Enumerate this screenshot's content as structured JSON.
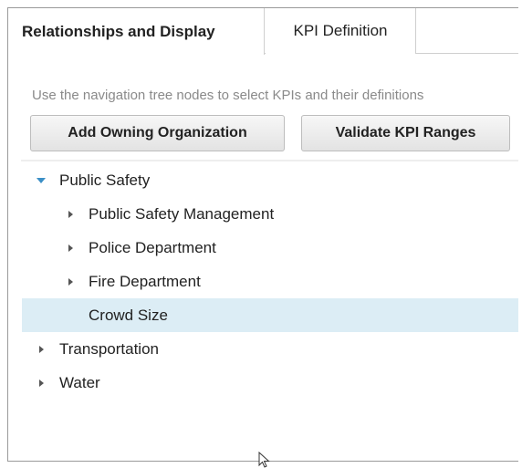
{
  "tabs": [
    {
      "label": "Relationships and Display",
      "active": true
    },
    {
      "label": "KPI Definition",
      "active": false
    }
  ],
  "hint_text": "Use the navigation tree nodes to select KPIs and their definitions",
  "buttons": {
    "add_owning": "Add Owning Organization",
    "validate": "Validate KPI Ranges"
  },
  "tree": {
    "public_safety": "Public Safety",
    "ps_management": "Public Safety Management",
    "police": "Police Department",
    "fire": "Fire Department",
    "crowd_size": "Crowd Size",
    "transportation": "Transportation",
    "water": "Water"
  },
  "colors": {
    "selected_row": "#dcedf5",
    "expanded_caret": "#3b8fc6"
  },
  "icons": {
    "expanded": "caret-down-icon",
    "collapsed": "caret-right-icon",
    "pointer": "mouse-pointer-icon"
  }
}
